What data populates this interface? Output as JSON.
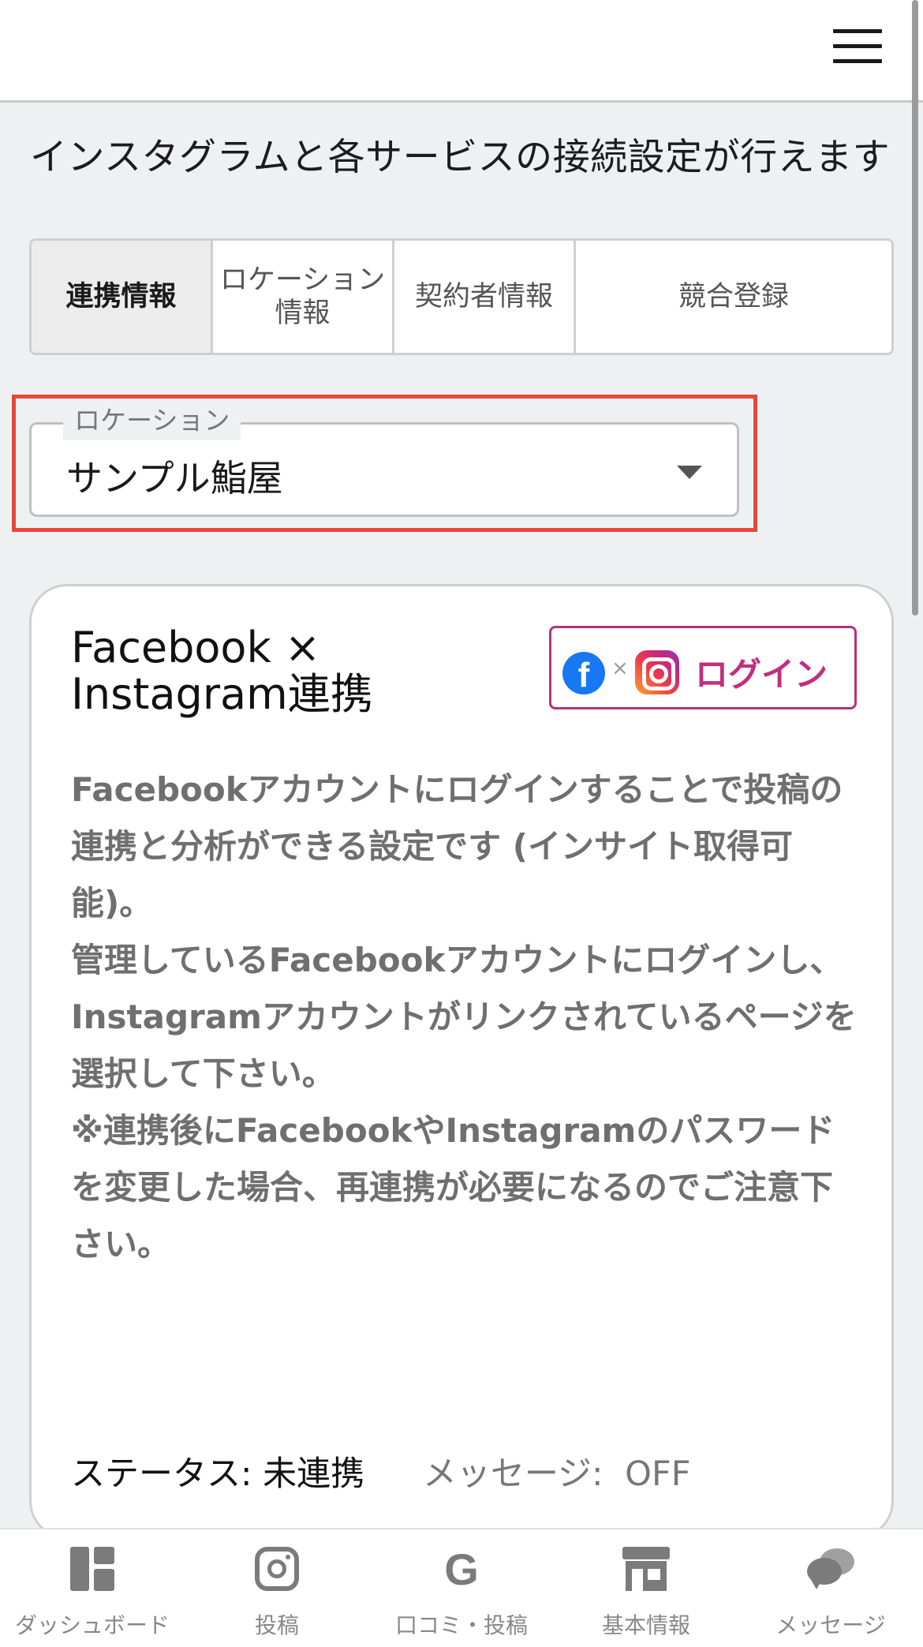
{
  "header": {
    "menu_icon": "hamburger-menu-icon"
  },
  "intro_text": "インスタグラムと各サービスの接続設定が行えます",
  "tabs": [
    {
      "label": "連携情報",
      "active": true
    },
    {
      "label": "ロケーション\n情報",
      "active": false
    },
    {
      "label": "契約者情報",
      "active": false
    },
    {
      "label": "競合登録",
      "active": false
    }
  ],
  "location_select": {
    "legend": "ロケーション",
    "value": "サンプル鮨屋"
  },
  "card": {
    "title": "Facebook × Instagram連携",
    "login_button": {
      "label": "ログイン",
      "icons": [
        "facebook-icon",
        "instagram-icon"
      ],
      "accent_color": "#c0307d"
    },
    "description": [
      "Facebookアカウントにログインすることで投稿の連携と分析ができる設定です (インサイト取得可能)。",
      "管理しているFacebookアカウントにログインし、Instagramアカウントがリンクされているページを選択して下さい。",
      "※連携後にFacebookやInstagramのパスワードを変更した場合、再連携が必要になるのでご注意下さい。"
    ],
    "status_label": "ステータス:",
    "status_value": "未連携",
    "message_label": "メッセージ:",
    "message_value": "OFF"
  },
  "bottom_nav": [
    {
      "label": "ダッシュボード",
      "icon": "dashboard-icon"
    },
    {
      "label": "投稿",
      "icon": "instagram-icon"
    },
    {
      "label": "口コミ・投稿",
      "icon": "google-icon"
    },
    {
      "label": "基本情報",
      "icon": "store-icon"
    },
    {
      "label": "メッセージ",
      "icon": "chat-icon"
    }
  ],
  "colors": {
    "highlight_border": "#e5473a",
    "background": "#eef1f2"
  }
}
